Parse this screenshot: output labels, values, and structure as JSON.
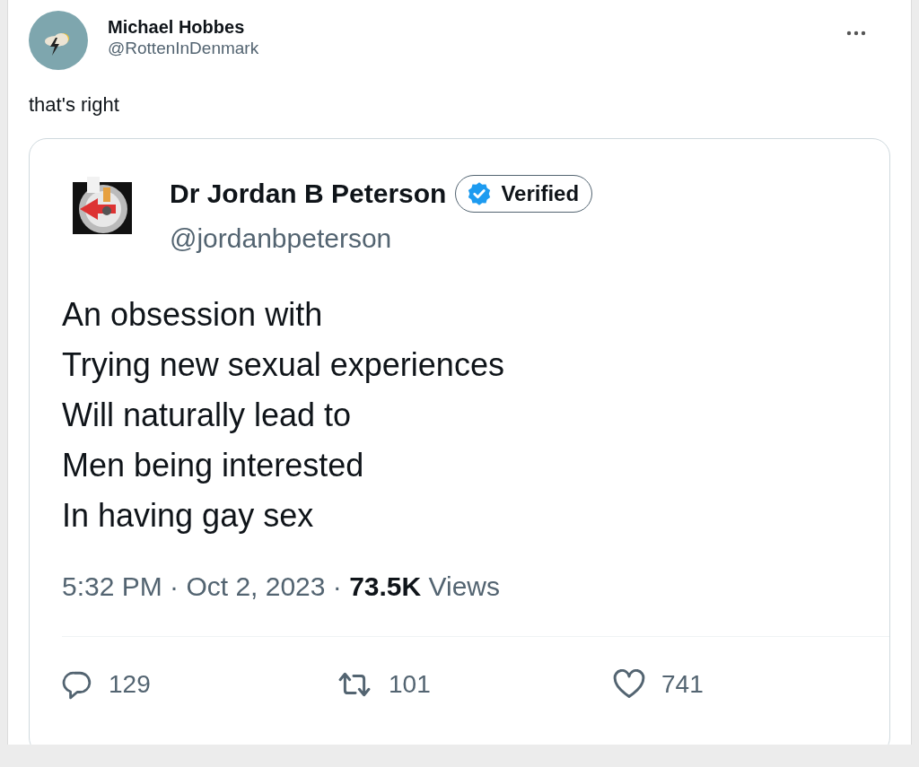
{
  "post": {
    "author": {
      "name": "Michael Hobbes",
      "handle": "@RottenInDenmark"
    },
    "text": "that's right",
    "quoted": {
      "author": {
        "name": "Dr Jordan B Peterson",
        "handle": "@jordanbpeterson",
        "badge": "Verified"
      },
      "lines": [
        "An obsession with",
        "Trying new sexual experiences",
        "Will naturally lead to",
        "Men being interested",
        "In having gay sex"
      ],
      "meta": "5:32 PM · Oct 2, 2023 · **73.5K** Views",
      "actions": [
        {
          "kind": "reply",
          "count": "129"
        },
        {
          "kind": "repost",
          "count": "101"
        },
        {
          "kind": "like",
          "count": "741"
        }
      ]
    }
  }
}
